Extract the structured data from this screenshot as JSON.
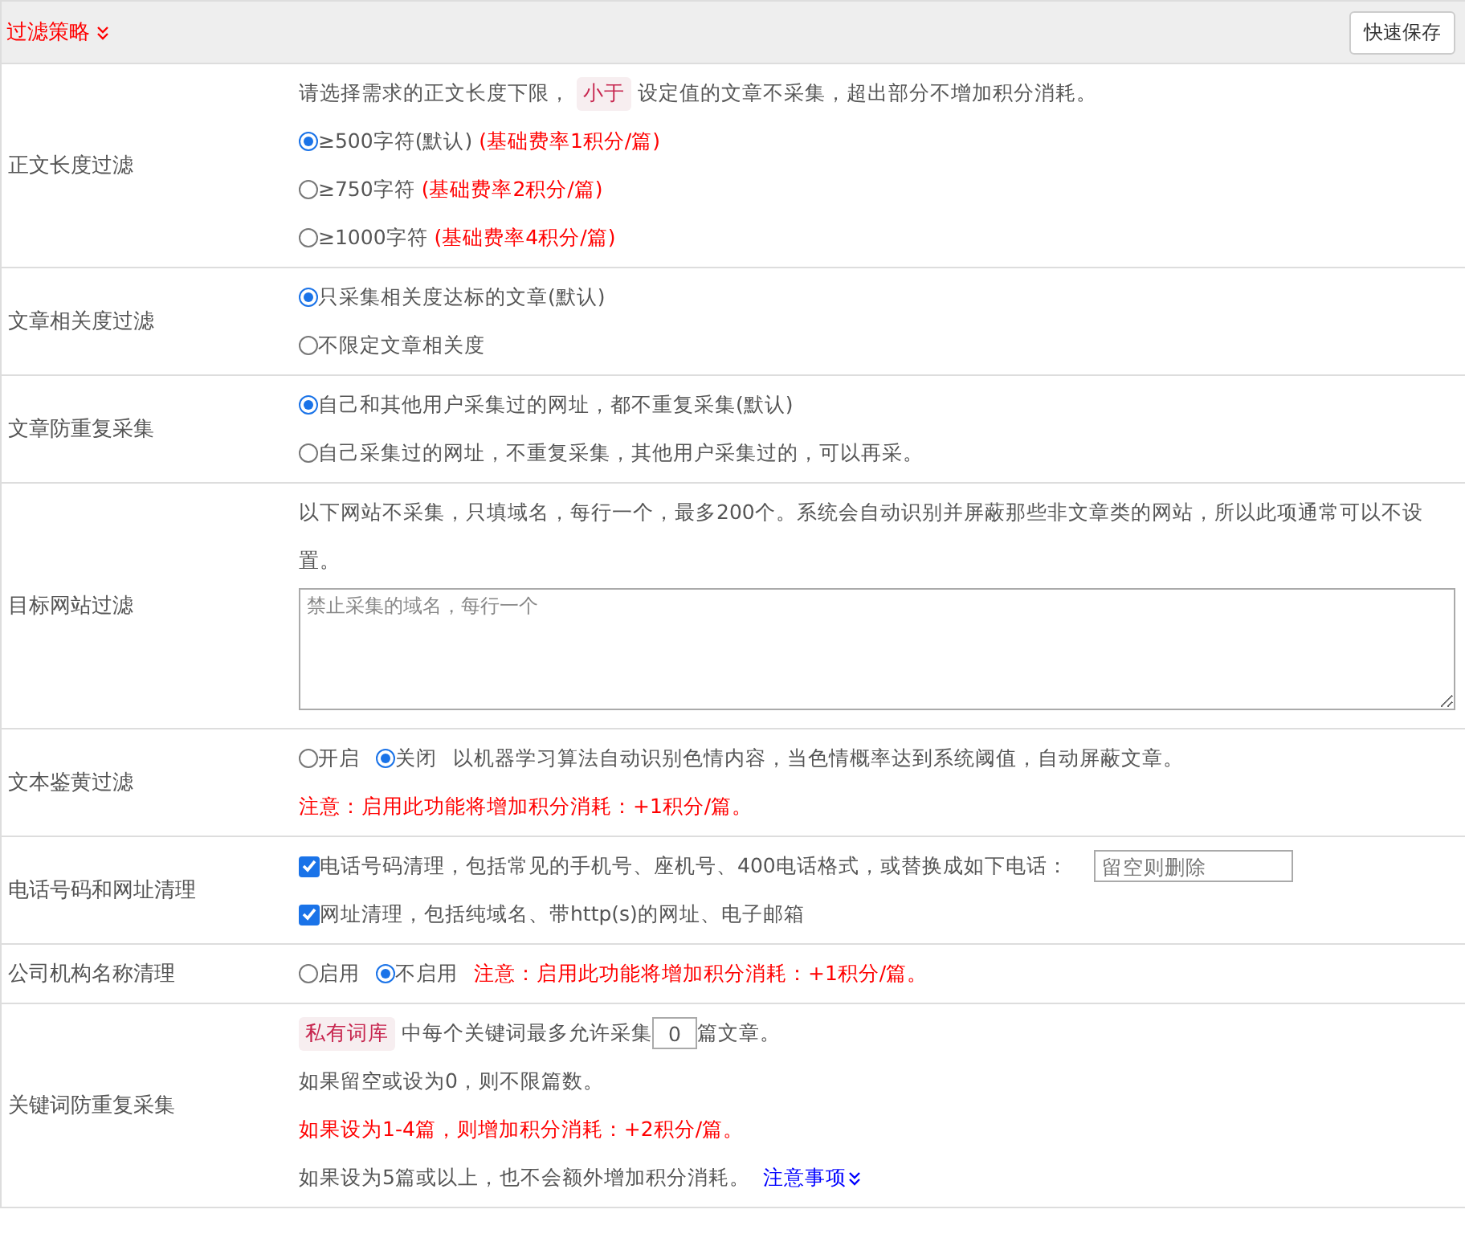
{
  "header": {
    "title": "过滤策略",
    "save_button": "快速保存"
  },
  "rows": [
    {
      "label": "正文长度过滤",
      "lines": [
        {
          "kind": "intro",
          "before": "请选择需求的正文长度下限，",
          "tag": "小于",
          "after": "设定值的文章不采集，超出部分不增加积分消耗。"
        },
        {
          "kind": "radio",
          "label": "≥500字符(默认)",
          "note": "(基础费率1积分/篇)",
          "selected": true
        },
        {
          "kind": "radio",
          "label": "≥750字符",
          "note": "(基础费率2积分/篇)",
          "selected": false
        },
        {
          "kind": "radio",
          "label": "≥1000字符",
          "note": "(基础费率4积分/篇)",
          "selected": false
        }
      ]
    },
    {
      "label": "文章相关度过滤",
      "lines": [
        {
          "kind": "radio",
          "label": "只采集相关度达标的文章(默认)",
          "selected": true
        },
        {
          "kind": "radio",
          "label": "不限定文章相关度",
          "selected": false
        }
      ]
    },
    {
      "label": "文章防重复采集",
      "lines": [
        {
          "kind": "radio",
          "label": "自己和其他用户采集过的网址，都不重复采集(默认)",
          "selected": true
        },
        {
          "kind": "radio",
          "label": "自己采集过的网址，不重复采集，其他用户采集过的，可以再采。",
          "selected": false
        }
      ]
    },
    {
      "label": "目标网站过滤",
      "lines": [
        {
          "kind": "text",
          "text": "以下网站不采集，只填域名，每行一个，最多200个。系统会自动识别并屏蔽那些非文章类的网站，所以此项通常可以不设置。"
        },
        {
          "kind": "textarea",
          "placeholder": "禁止采集的域名，每行一个"
        }
      ]
    },
    {
      "label": "文本鉴黄过滤",
      "lines": [
        {
          "kind": "options",
          "options": [
            {
              "label": "开启",
              "selected": false
            },
            {
              "label": "关闭",
              "selected": true
            }
          ],
          "note": "以机器学习算法自动识别色情内容，当色情概率达到系统阈值，自动屏蔽文章。",
          "warn": false
        },
        {
          "kind": "warning",
          "text": "注意：启用此功能将增加积分消耗：+1积分/篇。"
        }
      ]
    },
    {
      "label": "电话号码和网址清理",
      "lines": [
        {
          "kind": "check",
          "label": "电话号码清理，包括常见的手机号、座机号、400电话格式，或替换成如下电话：",
          "checked": true,
          "placeholder": "留空则删除"
        },
        {
          "kind": "check",
          "label": "网址清理，包括纯域名、带http(s)的网址、电子邮箱",
          "checked": true
        }
      ]
    },
    {
      "label": "公司机构名称清理",
      "lines": [
        {
          "kind": "options",
          "options": [
            {
              "label": "启用",
              "selected": false
            },
            {
              "label": "不启用",
              "selected": true
            }
          ],
          "note": "注意：启用此功能将增加积分消耗：+1积分/篇。",
          "warn": true
        }
      ]
    },
    {
      "label": "关键词防重复采集",
      "lines": [
        {
          "kind": "quota",
          "tag": "私有词库",
          "before": "中每个关键词最多允许采集",
          "value": "0",
          "after": "篇文章。"
        },
        {
          "kind": "text",
          "text": "如果留空或设为0，则不限篇数。"
        },
        {
          "kind": "warning",
          "text": "如果设为1-4篇，则增加积分消耗：+2积分/篇。"
        },
        {
          "kind": "link_text",
          "text": "如果设为5篇或以上，也不会额外增加积分消耗。",
          "link": "注意事项"
        }
      ]
    }
  ]
}
